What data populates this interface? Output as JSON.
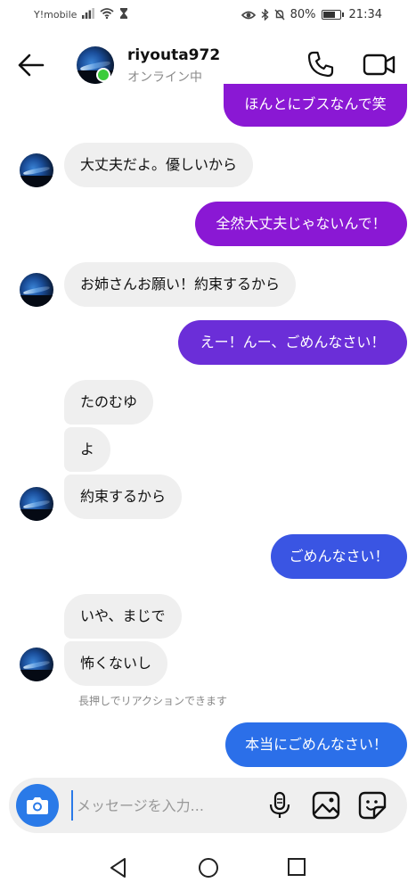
{
  "status_bar": {
    "carrier": "Y!mobile",
    "battery": "80%",
    "battery_level": 0.8,
    "time": "21:34"
  },
  "header": {
    "name": "riyouta972",
    "status": "オンライン中"
  },
  "messages": [
    {
      "text": "ほんとにブスなんで笑",
      "direction": "outgoing",
      "color": "#8a18d4"
    },
    {
      "text": "大丈夫だよ。優しいから",
      "direction": "incoming"
    },
    {
      "text": "全然大丈夫じゃないんで！",
      "direction": "outgoing",
      "color": "#8a18d4"
    },
    {
      "text": "お姉さんお願い！約束するから",
      "direction": "incoming"
    },
    {
      "text": "えー！んー、ごめんなさい！",
      "direction": "outgoing",
      "color": "#6b2ed8"
    },
    {
      "text": "たのむゆ",
      "direction": "incoming"
    },
    {
      "text": "よ",
      "direction": "incoming"
    },
    {
      "text": "約束するから",
      "direction": "incoming"
    },
    {
      "text": "ごめんなさい！",
      "direction": "outgoing",
      "color": "#3a55e3"
    },
    {
      "text": "いや、まじで",
      "direction": "incoming"
    },
    {
      "text": "怖くないし",
      "direction": "incoming"
    },
    {
      "text": "本当にごめんなさい！",
      "direction": "outgoing",
      "color": "#2b6fe9"
    }
  ],
  "hint": "長押しでリアクションできます",
  "composer": {
    "placeholder": "メッセージを入力..."
  },
  "colors": {
    "online": "#3bcc3b",
    "camera_button": "#2a7ae8",
    "incoming_bubble": "#efefef"
  }
}
